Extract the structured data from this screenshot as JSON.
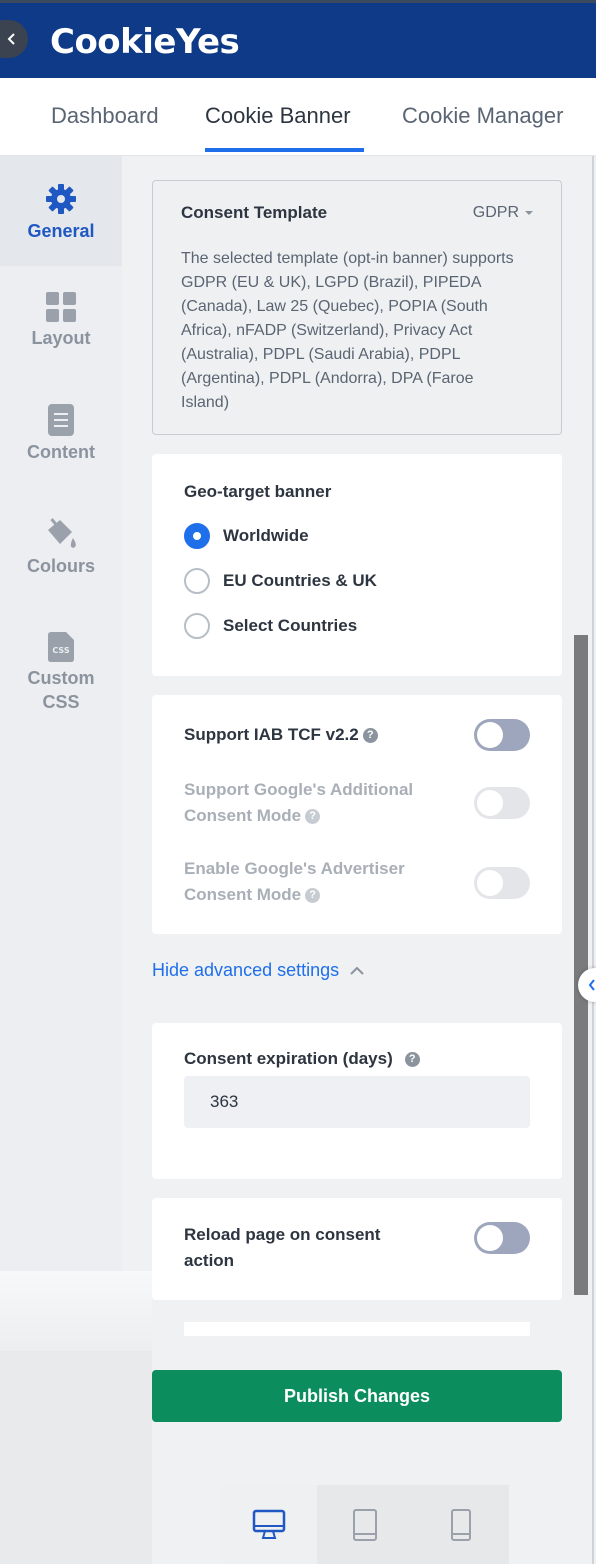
{
  "header": {
    "logo_text": "CookieYes"
  },
  "tabs": [
    {
      "label": "Dashboard"
    },
    {
      "label": "Cookie Banner"
    },
    {
      "label": "Cookie Manager"
    }
  ],
  "sidebar": {
    "items": [
      {
        "label": "General",
        "icon": "gear-icon"
      },
      {
        "label": "Layout",
        "icon": "grid-icon"
      },
      {
        "label": "Content",
        "icon": "document-icon"
      },
      {
        "label": "Colours",
        "icon": "paint-bucket-icon"
      },
      {
        "label": "Custom CSS",
        "icon": "css-file-icon"
      }
    ]
  },
  "consent_template": {
    "title": "Consent Template",
    "selected": "GDPR",
    "description": "The selected template (opt-in banner) supports GDPR (EU & UK), LGPD (Brazil), PIPEDA (Canada), Law 25 (Quebec), POPIA (South Africa), nFADP (Switzerland), Privacy Act (Australia), PDPL (Saudi Arabia), PDPL (Argentina), PDPL (Andorra), DPA (Faroe Island)"
  },
  "geo_target": {
    "title": "Geo-target banner",
    "options": [
      {
        "label": "Worldwide",
        "checked": true
      },
      {
        "label": "EU Countries & UK",
        "checked": false
      },
      {
        "label": "Select Countries",
        "checked": false
      }
    ]
  },
  "toggles": {
    "iab": {
      "label": "Support IAB TCF v2.2",
      "on": false
    },
    "google_additional": {
      "label": "Support Google's Additional Consent Mode",
      "on": false,
      "disabled": true
    },
    "google_advertiser": {
      "label": "Enable Google's Advertiser Consent Mode",
      "on": false,
      "disabled": true
    }
  },
  "advanced": {
    "link_label": "Hide advanced settings"
  },
  "expiration": {
    "label": "Consent expiration (days)",
    "value": "363"
  },
  "reload": {
    "label": "Reload page on consent action",
    "on": false
  },
  "publish": {
    "label": "Publish Changes"
  },
  "devices": [
    {
      "icon": "desktop-icon",
      "active": true
    },
    {
      "icon": "tablet-icon",
      "active": false
    },
    {
      "icon": "mobile-icon",
      "active": false
    }
  ],
  "colors": {
    "brand": "#0f3a87",
    "accent": "#1f6feb",
    "publish": "#0b8d5e"
  }
}
